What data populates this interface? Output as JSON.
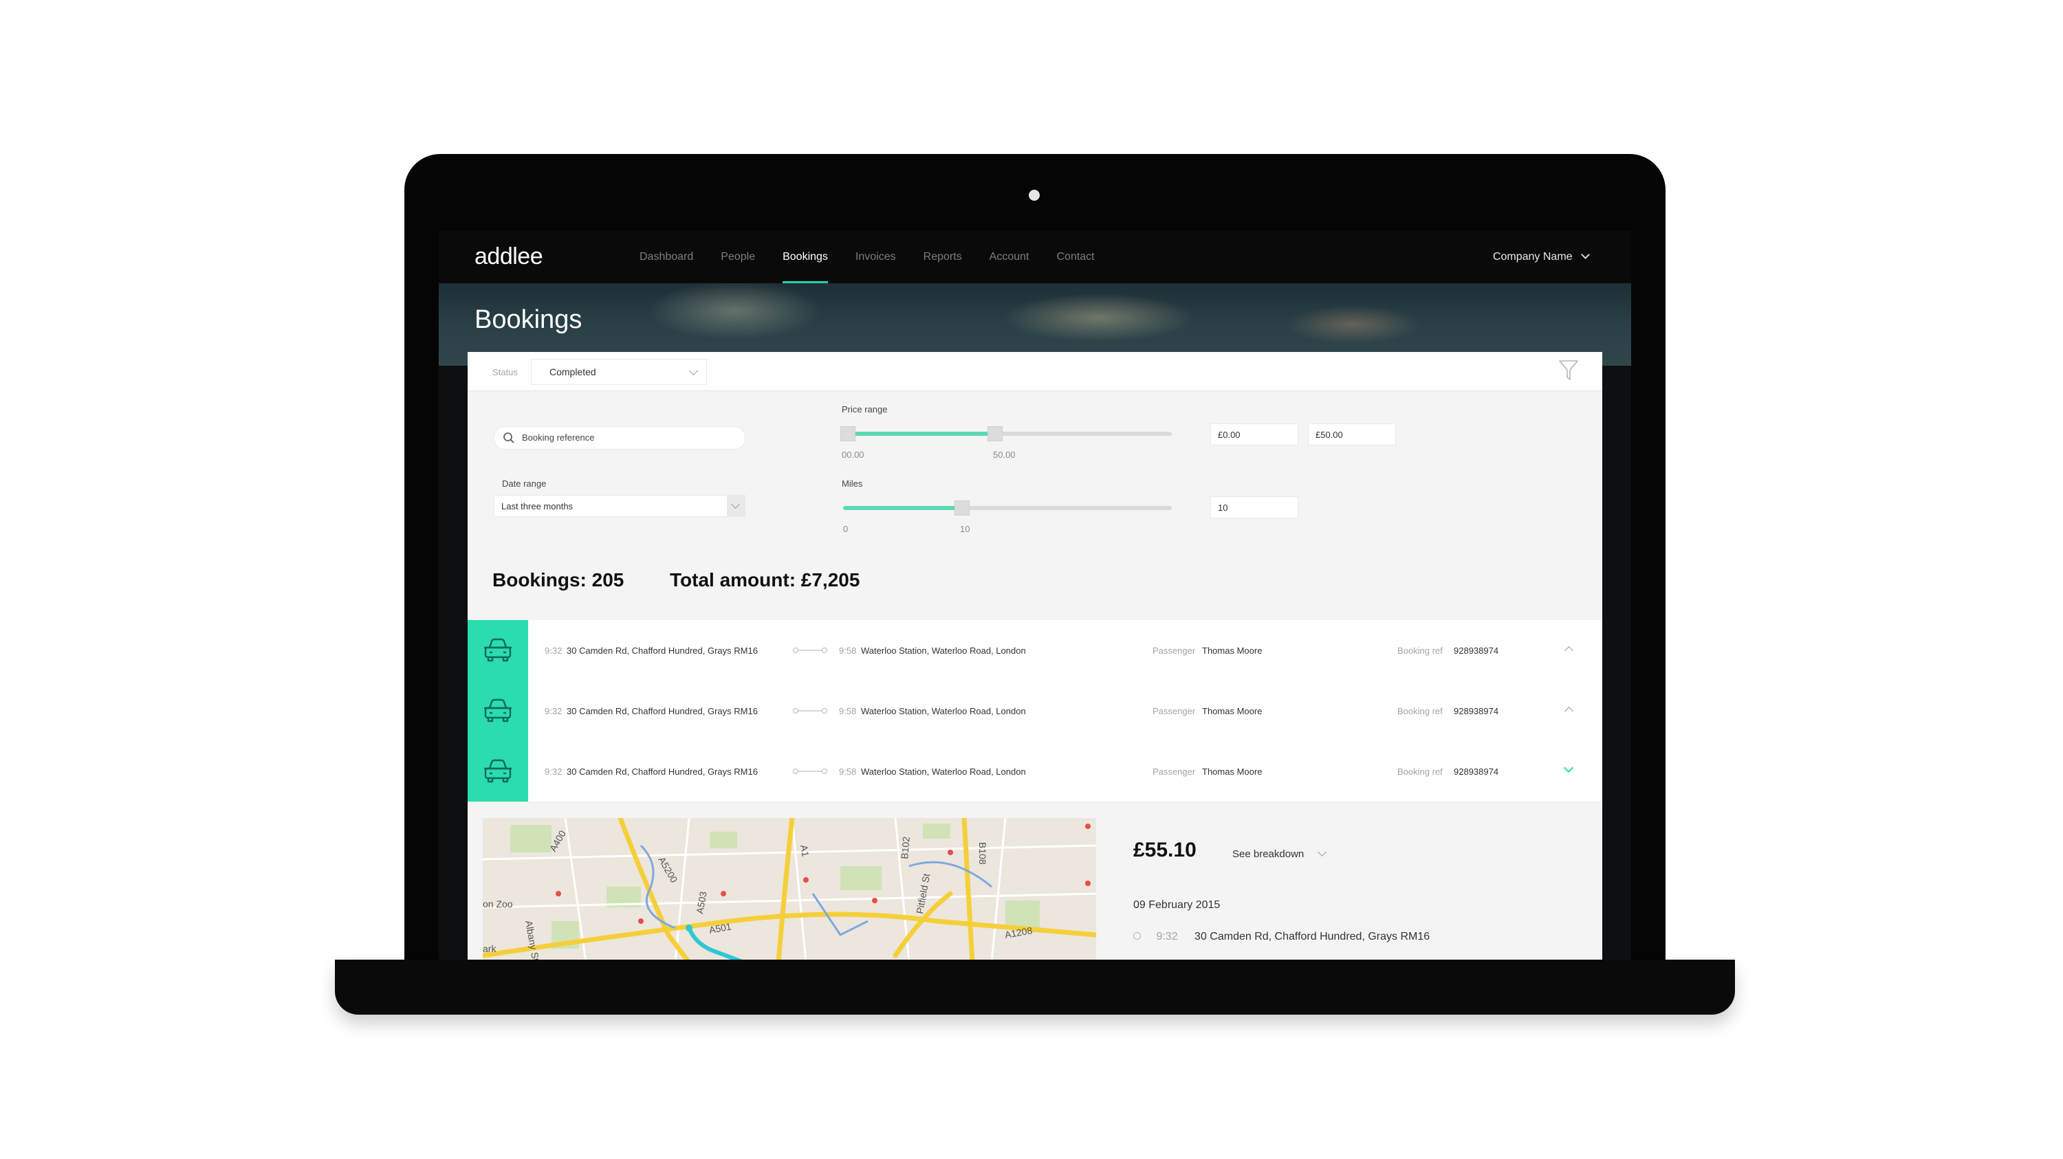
{
  "app": {
    "logo": "addlee",
    "nav": [
      "Dashboard",
      "People",
      "Bookings",
      "Invoices",
      "Reports",
      "Account",
      "Contact"
    ],
    "active_nav": "Bookings",
    "company": "Company Name"
  },
  "page": {
    "title": "Bookings"
  },
  "filters": {
    "status_label": "Status",
    "status_value": "Completed",
    "search_placeholder": "Booking reference",
    "date_label": "Date range",
    "date_value": "Last three months",
    "price_label": "Price range",
    "price_min_tick": "00.00",
    "price_max_tick": "50.00",
    "price_min": "£0.00",
    "price_max": "£50.00",
    "price_fill_fraction": 0.46,
    "miles_label": "Miles",
    "miles_min_tick": "0",
    "miles_tick": "10",
    "miles_value": "10",
    "miles_fill_fraction": 0.36
  },
  "summary": {
    "bookings": "Bookings: 205",
    "total": "Total amount: £7,205"
  },
  "bookings": [
    {
      "pickup_time": "9:32",
      "pickup": "30 Camden Rd, Chafford Hundred, Grays RM16",
      "drop_time": "9:58",
      "drop": "Waterloo Station, Waterloo Road, London",
      "passenger_label": "Passenger",
      "passenger": "Thomas Moore",
      "ref_label": "Booking ref",
      "ref": "928938974",
      "expanded": false
    },
    {
      "pickup_time": "9:32",
      "pickup": "30 Camden Rd, Chafford Hundred, Grays RM16",
      "drop_time": "9:58",
      "drop": "Waterloo Station, Waterloo Road, London",
      "passenger_label": "Passenger",
      "passenger": "Thomas Moore",
      "ref_label": "Booking ref",
      "ref": "928938974",
      "expanded": false
    },
    {
      "pickup_time": "9:32",
      "pickup": "30 Camden Rd, Chafford Hundred, Grays RM16",
      "drop_time": "9:58",
      "drop": "Waterloo Station, Waterloo Road, London",
      "passenger_label": "Passenger",
      "passenger": "Thomas Moore",
      "ref_label": "Booking ref",
      "ref": "928938974",
      "expanded": true
    }
  ],
  "detail": {
    "price": "£55.10",
    "breakdown": "See breakdown",
    "date": "09 February 2015",
    "leg_time": "9:32",
    "leg_address": "30 Camden Rd, Chafford Hundred, Grays RM16"
  },
  "map": {
    "labels": [
      "A400",
      "A5200",
      "A503",
      "A1",
      "B102",
      "B108",
      "A501",
      "Pitfield St",
      "A1208",
      "Albany St",
      "on Zoo",
      "ark"
    ]
  },
  "colors": {
    "accent": "#2bdcae",
    "slider_fill": "#5bd9b7"
  },
  "icons": {
    "car": "car-icon",
    "search": "search-icon",
    "filter": "filter-icon",
    "chevron": "chevron-icon"
  }
}
